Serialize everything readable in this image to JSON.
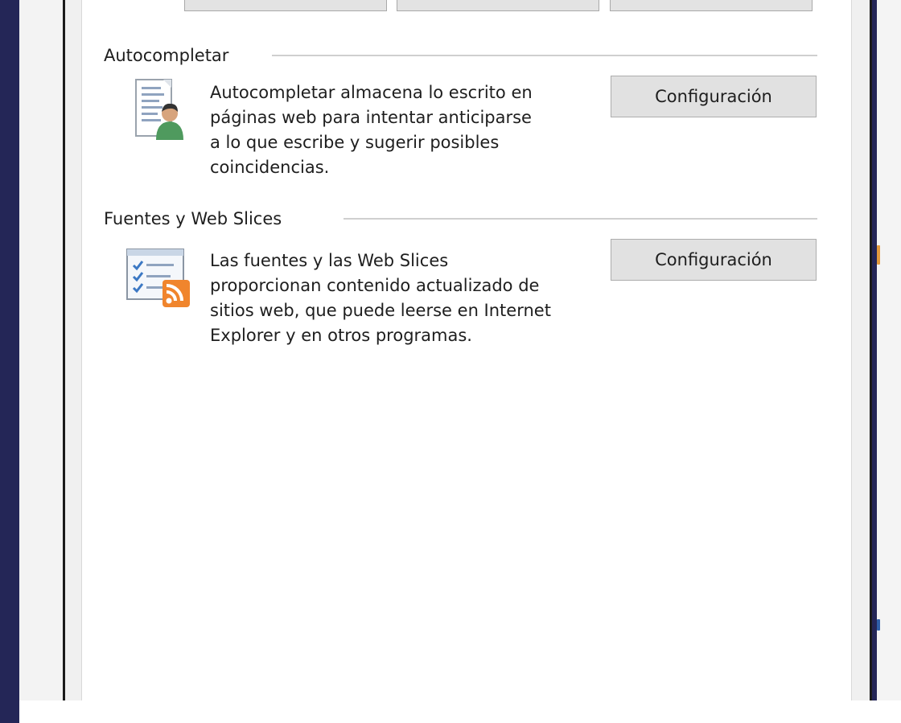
{
  "autocomplete": {
    "title": "Autocompletar",
    "description_lines": [
      "Autocompletar almacena lo escrito en",
      "páginas web para intentar anticiparse",
      "a lo que escribe y sugerir posibles",
      "coincidencias."
    ],
    "button_label": "Configuración",
    "icon": "autocomplete-form-user-icon"
  },
  "feeds": {
    "title": "Fuentes y Web Slices",
    "description_lines": [
      "Las fuentes y las Web Slices",
      "proporcionan contenido actualizado de",
      "sitios web, que puede leerse en Internet",
      "Explorer y en otros programas."
    ],
    "button_label": "Configuración",
    "icon": "feeds-rss-checklist-icon"
  },
  "colors": {
    "desktop": "#242657",
    "dialog_bg": "#f0f0f0",
    "panel_bg": "#ffffff",
    "button_bg": "#e1e1e1",
    "button_border": "#adadad",
    "rss_orange": "#f0852d"
  }
}
